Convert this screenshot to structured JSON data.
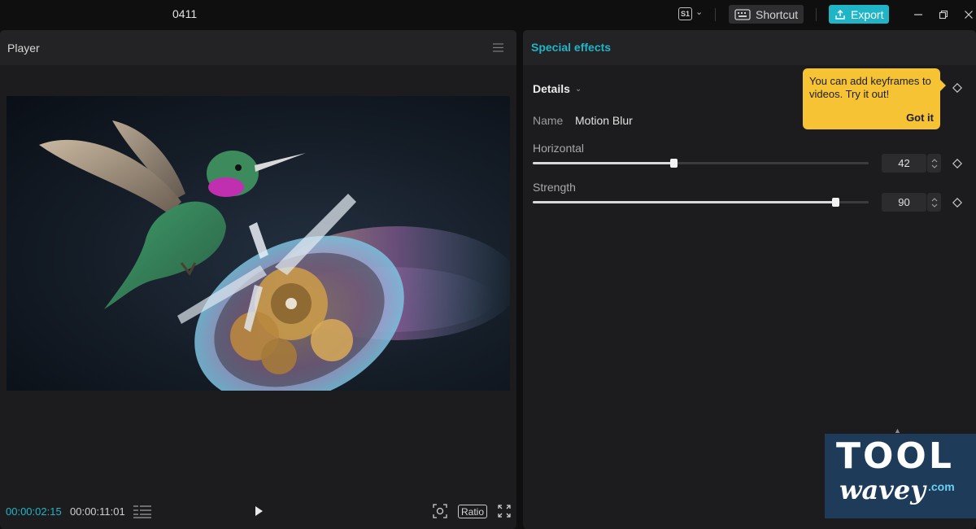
{
  "titlebar": {
    "project_name": "0411",
    "badge": "S1",
    "shortcut_label": "Shortcut",
    "export_label": "Export"
  },
  "player": {
    "title": "Player",
    "time_current": "00:00:02:15",
    "time_total": "00:00:11:01",
    "ratio_label": "Ratio"
  },
  "effects": {
    "title": "Special effects",
    "section_label": "Details",
    "name_label": "Name",
    "name_value": "Motion Blur",
    "params": [
      {
        "label": "Horizontal",
        "value": "42",
        "fraction": 0.42
      },
      {
        "label": "Strength",
        "value": "90",
        "fraction": 0.9
      }
    ],
    "tooltip": {
      "text": "You can add keyframes to videos. Try it out!",
      "button": "Got it"
    }
  },
  "watermark": {
    "line1": "TOOL",
    "line2": "wavey",
    "line3": ".com"
  },
  "colors": {
    "accent": "#1fb5c7",
    "tooltip": "#f5c334",
    "panel": "#1c1c1e",
    "background": "#0f0f10"
  }
}
